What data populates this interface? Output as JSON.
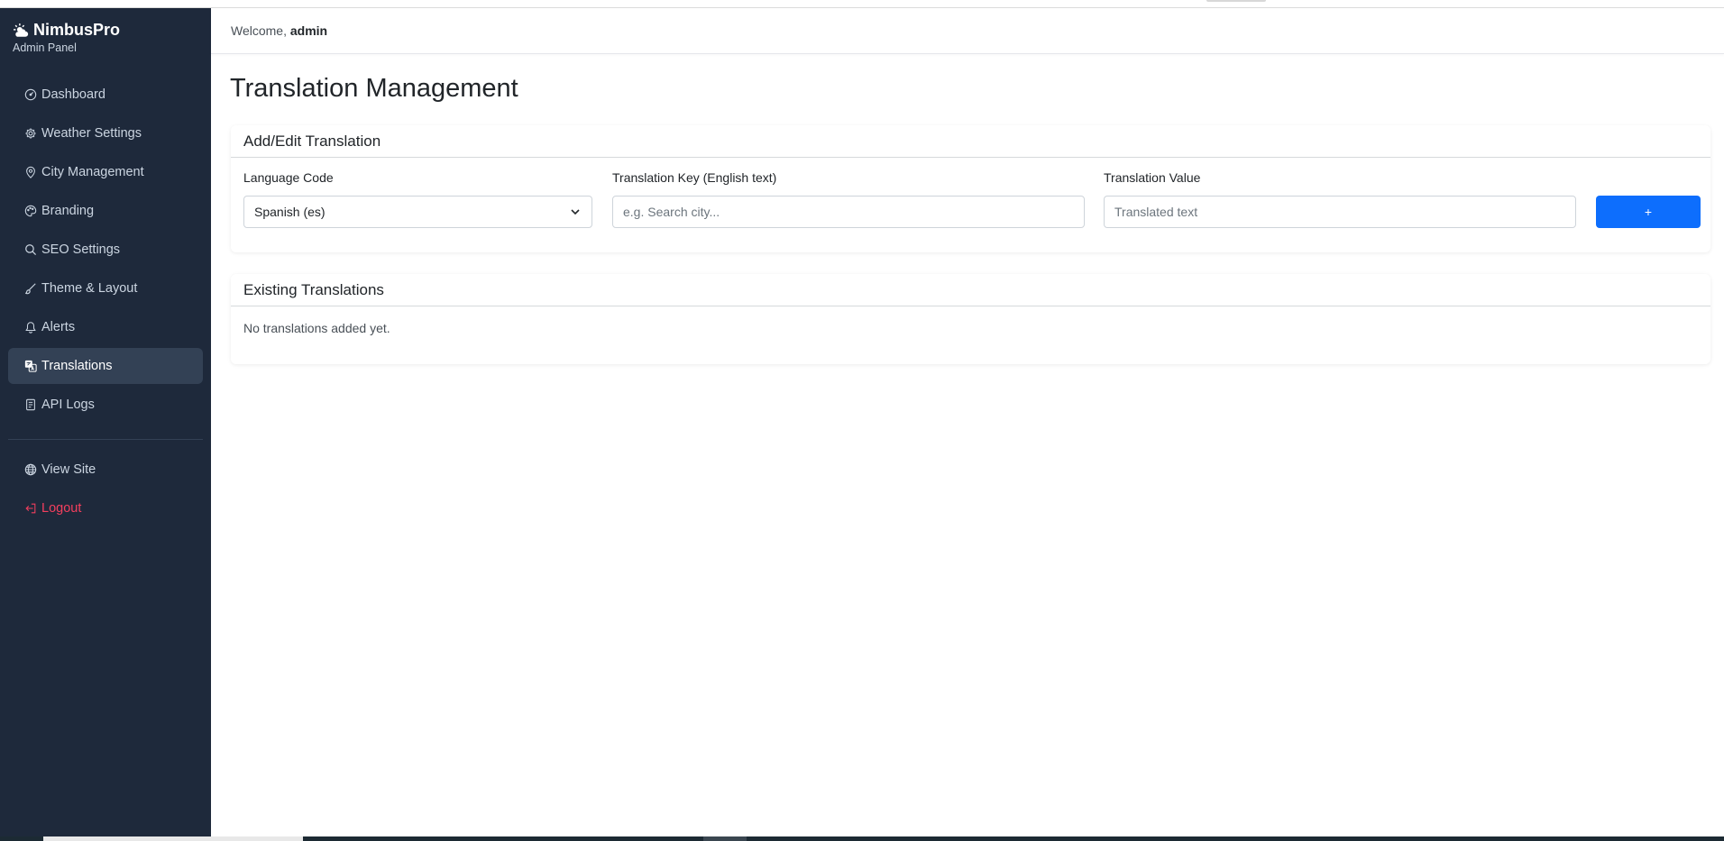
{
  "app": {
    "name": "NimbusPro",
    "subtitle": "Admin Panel"
  },
  "header": {
    "welcome_prefix": "Welcome, ",
    "username": "admin"
  },
  "sidebar": {
    "items": [
      {
        "label": "Dashboard",
        "icon": "speedometer-icon"
      },
      {
        "label": "Weather Settings",
        "icon": "gear-icon"
      },
      {
        "label": "City Management",
        "icon": "map-pin-icon"
      },
      {
        "label": "Branding",
        "icon": "palette-icon"
      },
      {
        "label": "SEO Settings",
        "icon": "search-icon"
      },
      {
        "label": "Theme & Layout",
        "icon": "brush-icon"
      },
      {
        "label": "Alerts",
        "icon": "bell-icon"
      },
      {
        "label": "Translations",
        "icon": "translate-icon",
        "active": true
      },
      {
        "label": "API Logs",
        "icon": "document-icon"
      }
    ],
    "footer_items": [
      {
        "label": "View Site",
        "icon": "globe-icon"
      },
      {
        "label": "Logout",
        "icon": "logout-icon",
        "color": "#f43f5e"
      }
    ]
  },
  "page": {
    "title": "Translation Management"
  },
  "add_card": {
    "title": "Add/Edit Translation",
    "language_label": "Language Code",
    "language_value": "Spanish (es)",
    "key_label": "Translation Key (English text)",
    "key_placeholder": "e.g. Search city...",
    "value_label": "Translation Value",
    "value_placeholder": "Translated text",
    "add_button_label": "+"
  },
  "list_card": {
    "title": "Existing Translations",
    "empty_message": "No translations added yet."
  },
  "colors": {
    "sidebar_bg": "#1e293b",
    "active_item_bg": "#334155",
    "primary": "#0d6efd",
    "danger": "#f43f5e"
  }
}
